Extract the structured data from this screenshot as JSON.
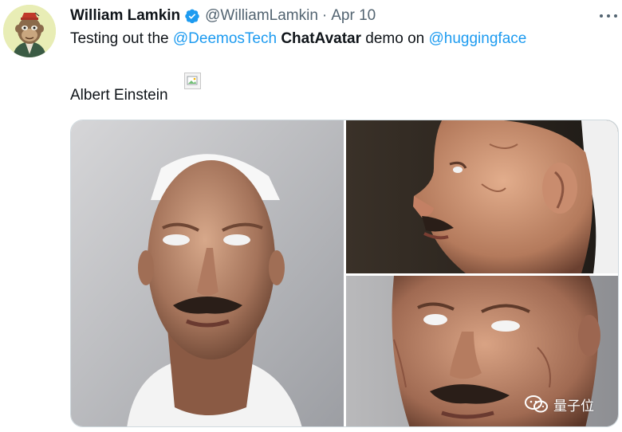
{
  "tweet": {
    "author_name": "William Lamkin",
    "handle": "@WilliamLamkin",
    "separator": "·",
    "date": "Apr 10",
    "verified": true,
    "more_icon": "more-horizontal-icon",
    "text": {
      "prefix": "Testing out the ",
      "mention_1": "@DeemosTech",
      "space_1": " ",
      "bold_word": "ChatAvatar",
      "mid": " demo on ",
      "mention_2": "@huggingface",
      "line2": "Albert Einstein"
    },
    "media": [
      {
        "view": "front"
      },
      {
        "view": "profile-left"
      },
      {
        "view": "close-up"
      }
    ]
  },
  "watermark": {
    "icon": "wechat-icon",
    "text": "量子位"
  },
  "colors": {
    "link": "#1d9bf0",
    "verified": "#1d9bf0",
    "text": "#0f1419",
    "muted": "#536471"
  }
}
